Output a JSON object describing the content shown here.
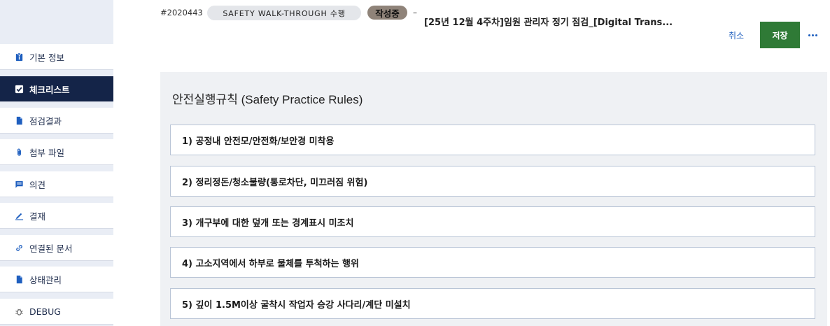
{
  "header": {
    "doc_id": "#2020443",
    "type_pill": "SAFETY WALK-THROUGH 수행",
    "status": "작성중",
    "separator": "–",
    "title": "[25년 12월 4주차]임원 관리자 정기 점검_[Digital Trans...",
    "cancel_label": "취소",
    "save_label": "저장",
    "more_icon": "more-horizontal-icon",
    "status_color": "#8f8379",
    "save_color": "#2f7a36"
  },
  "sidebar": {
    "items": [
      {
        "label": "기본 정보",
        "icon": "info-clipboard-icon"
      },
      {
        "label": "체크리스트",
        "icon": "checkbox-icon",
        "active": true
      },
      {
        "label": "점검결과",
        "icon": "document-icon"
      },
      {
        "label": "첨부 파일",
        "icon": "paperclip-icon"
      },
      {
        "label": "의견",
        "icon": "comment-icon"
      },
      {
        "label": "결재",
        "icon": "pen-icon"
      },
      {
        "label": "연결된 문서",
        "icon": "link-icon"
      },
      {
        "label": "상태관리",
        "icon": "document-icon"
      },
      {
        "label": "DEBUG",
        "icon": "bug-icon"
      }
    ],
    "active_color": "#142448"
  },
  "main": {
    "section_title": "안전실행규칙 (Safety Practice Rules)",
    "rules": [
      "1) 공정내 안전모/안전화/보안경 미착용",
      "2) 정리정돈/청소불량(통로차단, 미끄러짐 위험)",
      "3) 개구부에 대한 덮개 또는 경계표시 미조치",
      "4) 고소지역에서 하부로 물체를 투척하는 행위",
      "5) 깊이 1.5M이상 굴착시 작업자 승강 사다리/계단 미설치"
    ]
  }
}
